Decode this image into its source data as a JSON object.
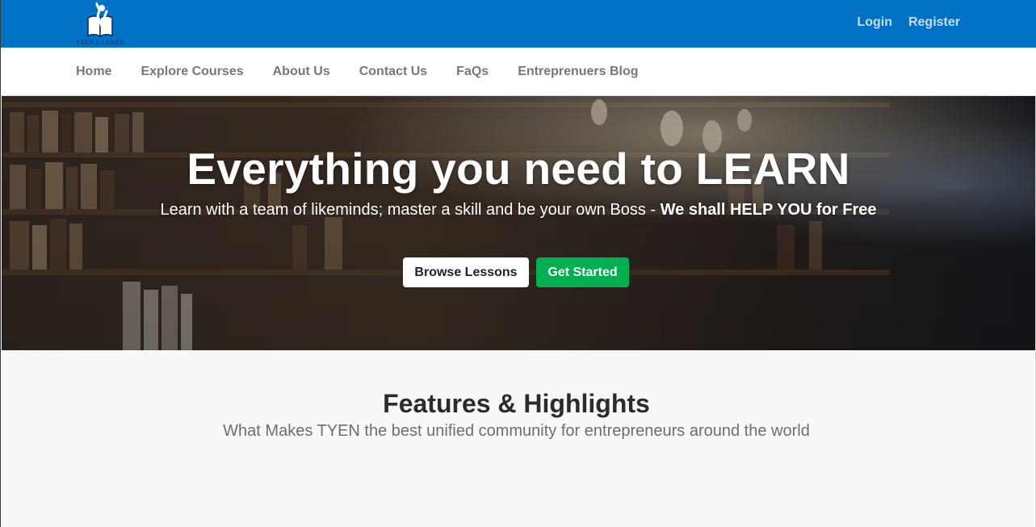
{
  "header": {
    "logo_text": "TYEN E-LEARN",
    "login": "Login",
    "register": "Register",
    "colors": {
      "bar": "#0072c6",
      "auth_link": "#c6dcf2"
    }
  },
  "nav": {
    "items": [
      "Home",
      "Explore Courses",
      "About Us",
      "Contact Us",
      "FaQs",
      "Entreprenuers Blog"
    ]
  },
  "hero": {
    "title": "Everything you need to LEARN",
    "subtitle_plain": "Learn with a team of likeminds; master a skill and be your own Boss - ",
    "subtitle_bold": "We shall HELP YOU for Free",
    "browse_button": "Browse Lessons",
    "start_button": "Get Started",
    "colors": {
      "start_button": "#00b050"
    }
  },
  "features": {
    "title": "Features & Highlights",
    "subtitle": "What Makes TYEN the best unified community for entrepreneurs around the world"
  }
}
